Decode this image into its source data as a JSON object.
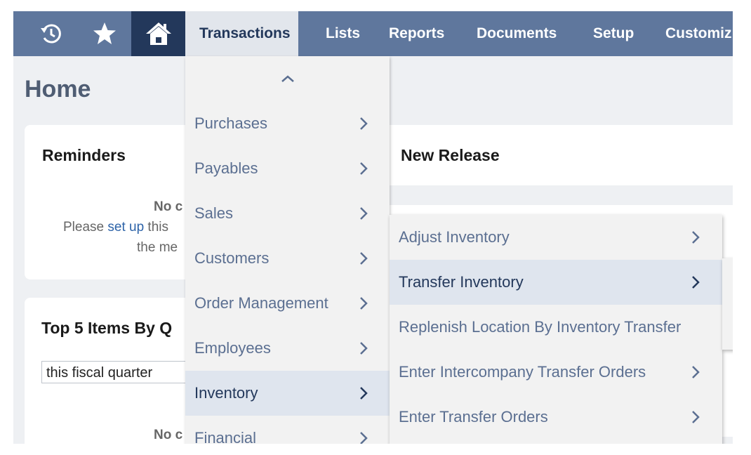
{
  "nav": {
    "icons": [
      "recent-records-icon",
      "favorites-star-icon",
      "home-icon"
    ],
    "items": [
      "Transactions",
      "Lists",
      "Reports",
      "Documents",
      "Setup",
      "Customiz"
    ]
  },
  "page": {
    "title": "Home",
    "reminders": {
      "title": "Reminders",
      "line1": "No c",
      "line2_prefix": "Please ",
      "line2_link": "set up",
      "line2_suffix": " this",
      "line3": "the me"
    },
    "new_release": {
      "title": "New Release"
    },
    "top_items": {
      "title": "Top 5 Items By Q",
      "period": "this fiscal quarter",
      "empty": "No c"
    }
  },
  "menu_transactions": {
    "items": [
      "Purchases",
      "Payables",
      "Sales",
      "Customers",
      "Order Management",
      "Employees",
      "Inventory",
      "Financial"
    ],
    "selected": "Inventory"
  },
  "menu_inventory": {
    "items": [
      "Adjust Inventory",
      "Transfer Inventory",
      "Replenish Location By Inventory Transfer",
      "Enter Intercompany Transfer Orders",
      "Enter Transfer Orders"
    ],
    "selected": "Transfer Inventory"
  },
  "colors": {
    "nav_bg": "#5f779d",
    "nav_home_bg": "#23385b",
    "menu_bg": "#f2f2f2",
    "menu_text": "#5b6f91",
    "menu_selected_bg": "#dfe5ee",
    "link": "#2d63a8"
  }
}
